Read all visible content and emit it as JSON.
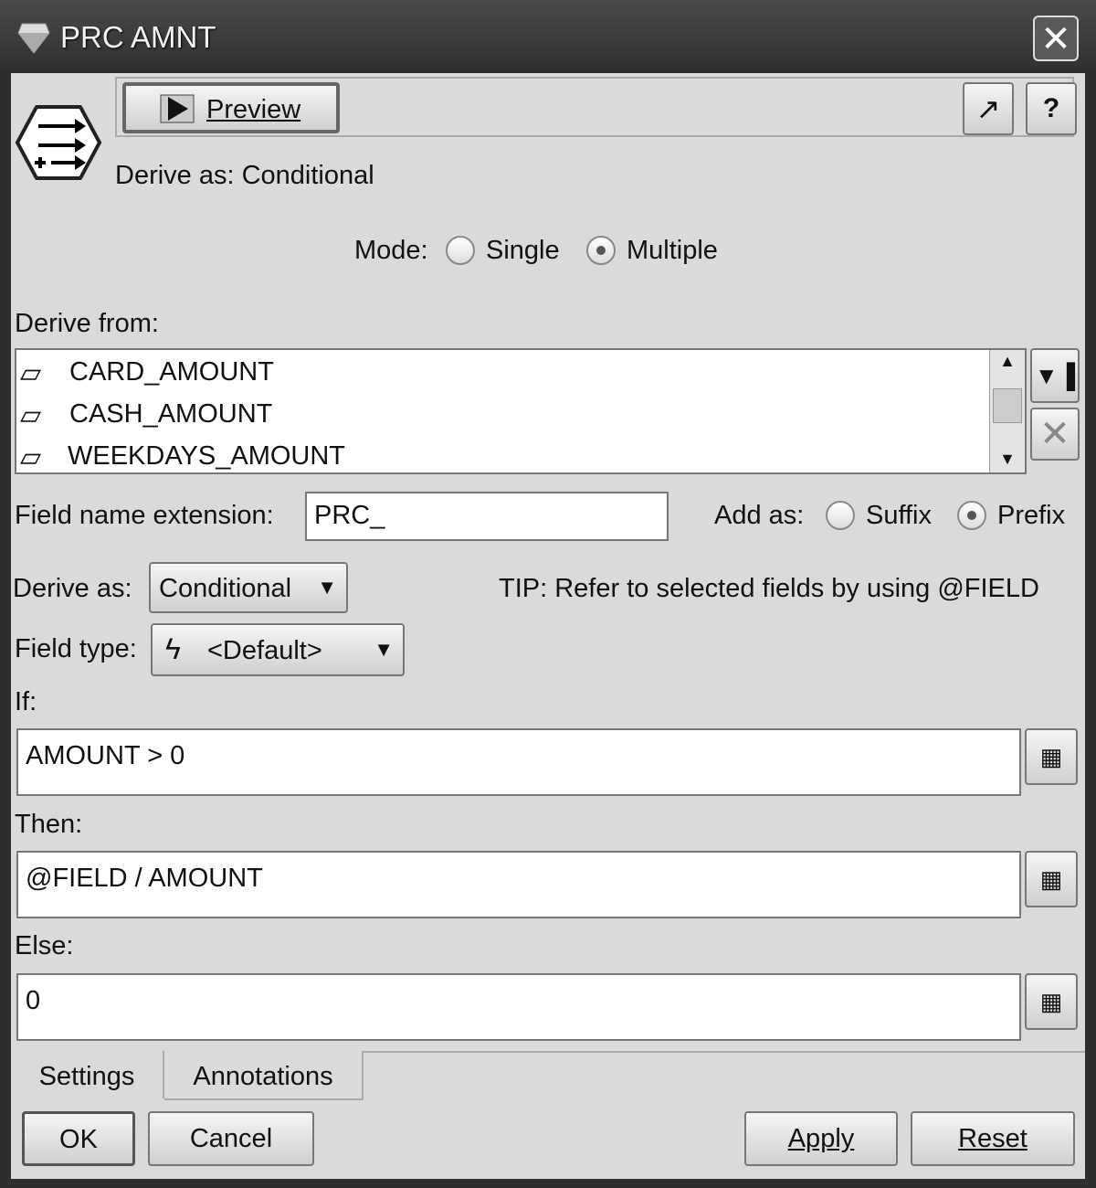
{
  "window": {
    "title": "PRC AMNT",
    "close_icon": "close-icon"
  },
  "toolbar": {
    "preview_label": "Preview",
    "preview_icon": "film-play-icon",
    "expand_icon": "arrow-up-right-icon",
    "help_icon": "question-mark-icon"
  },
  "node_icon": "derive-node-icon",
  "header": {
    "derive_summary": "Derive as: Conditional"
  },
  "mode": {
    "label": "Mode:",
    "options": [
      {
        "label": "Single",
        "selected": false
      },
      {
        "label": "Multiple",
        "selected": true
      }
    ]
  },
  "derive_from": {
    "label": "Derive from:",
    "items": [
      "CARD_AMOUNT",
      "CASH_AMOUNT",
      "WEEKDAYS_AMOUNT"
    ],
    "item_icon": "ruler-icon",
    "pick_icon": "field-picker-icon",
    "delete_icon": "delete-x-icon"
  },
  "extension": {
    "label": "Field name extension:",
    "value": "PRC_"
  },
  "add_as": {
    "label": "Add as:",
    "options": [
      {
        "label": "Suffix",
        "selected": false
      },
      {
        "label": "Prefix",
        "selected": true
      }
    ]
  },
  "derive_as": {
    "label": "Derive as:",
    "value": "Conditional"
  },
  "tip": "TIP: Refer to selected fields by using @FIELD",
  "field_type": {
    "label": "Field type:",
    "value": "<Default>",
    "icon": "lightning-icon"
  },
  "if": {
    "label": "If:",
    "value": "AMOUNT > 0"
  },
  "then": {
    "label": "Then:",
    "value": "@FIELD / AMOUNT"
  },
  "else": {
    "label": "Else:",
    "value": "0"
  },
  "tabs": [
    {
      "label": "Settings",
      "active": true
    },
    {
      "label": "Annotations",
      "active": false
    }
  ],
  "buttons": {
    "ok": "OK",
    "cancel": "Cancel",
    "apply": "Apply",
    "reset": "Reset"
  }
}
